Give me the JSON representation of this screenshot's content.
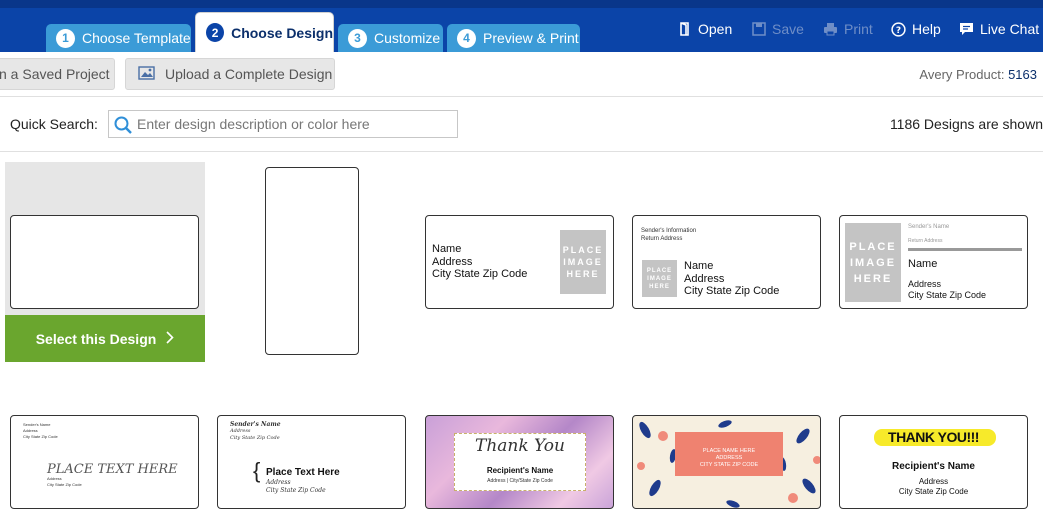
{
  "header": {
    "tabs": [
      {
        "num": "1",
        "label": "Choose Template"
      },
      {
        "num": "2",
        "label": "Choose Design"
      },
      {
        "num": "3",
        "label": "Customize"
      },
      {
        "num": "4",
        "label": "Preview & Print"
      }
    ],
    "tools": {
      "open": "Open",
      "save": "Save",
      "print": "Print",
      "help": "Help",
      "live_chat": "Live Chat"
    }
  },
  "actions": {
    "saved_project": "n a Saved Project",
    "upload": "Upload a Complete Design",
    "product_label": "Avery Product:",
    "product_number": "5163"
  },
  "search": {
    "label": "Quick Search:",
    "placeholder": "Enter design description or color here",
    "count": "1186 Designs are shown"
  },
  "designs": {
    "select_button": "Select this Design",
    "d3": {
      "name": "Name",
      "address": "Address",
      "city": "City State Zip Code",
      "placeholder": "PLACE IMAGE HERE"
    },
    "d4": {
      "sender": "Sender's Information",
      "return": "Return Address",
      "placeholder": "PLACE IMAGE HERE",
      "name": "Name",
      "address": "Address",
      "city": "City State Zip Code"
    },
    "d5": {
      "sender": "Sender's Name",
      "return": "Return Address",
      "placeholder": "PLACE IMAGE HERE",
      "name": "Name",
      "address": "Address",
      "city": "City State Zip Code"
    },
    "d6": {
      "sender": "Sender's Name",
      "address": "Address",
      "city": "City State Zip Code",
      "place": "PLACE TEXT HERE",
      "addr2": "Address",
      "city2": "City State Zip Code"
    },
    "d7": {
      "sender": "Sender's Name",
      "address": "Address",
      "city": "City State Zip Code",
      "place": "Place Text Here",
      "addr2": "Address",
      "city2": "City State Zip Code"
    },
    "d8": {
      "thank": "Thank You",
      "recipient": "Recipient's Name",
      "address": "Address | City/State Zip Code"
    },
    "d9": {
      "name": "PLACE NAME HERE",
      "address": "ADDRESS",
      "city": "CITY STATE ZIP CODE"
    },
    "d10": {
      "thank": "THANK YOU!!!",
      "recipient": "Recipient's Name",
      "address": "Address",
      "city": "City State Zip Code"
    }
  },
  "colors": {
    "header": "#0b44a8",
    "tab": "#3b9bd7",
    "select_green": "#6aa62e"
  }
}
